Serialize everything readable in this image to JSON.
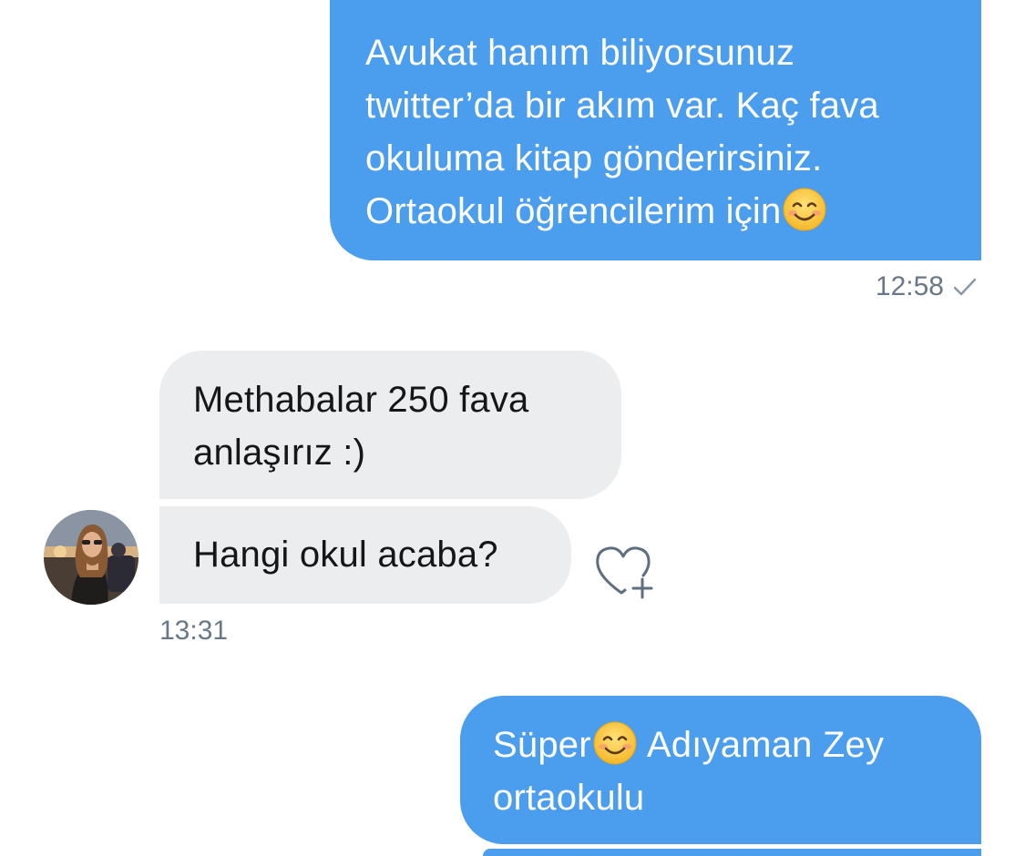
{
  "conversation": {
    "messages": [
      {
        "direction": "outgoing",
        "lines": [
          "Avukat hanım biliyorsunuz",
          "twitter’da bir akım var. Kaç fava",
          "okuluma kitap gönderirsiniz.",
          "Ortaokul öğrencilerim için"
        ],
        "trailing_emoji": "smiling-face-icon"
      },
      {
        "direction": "incoming",
        "lines": [
          "Methabalar 250 fava",
          "anlaşırız :)"
        ]
      },
      {
        "direction": "incoming",
        "lines": [
          "Hangi okul acaba?"
        ]
      },
      {
        "direction": "outgoing",
        "lines": [
          "Süper",
          " Adıyaman Zey",
          "ortaokulu"
        ],
        "inline_emoji": "smiling-face-icon"
      }
    ],
    "timestamps": {
      "first": "12:58",
      "second": "13:31"
    },
    "read_status": "sent-check",
    "like_action": "heart-plus-icon"
  },
  "colors": {
    "outgoing_bubble": "#4b9ded",
    "incoming_bubble": "#ecedef",
    "timestamp_text": "#697886",
    "icon_stroke": "#5f6f7f"
  }
}
